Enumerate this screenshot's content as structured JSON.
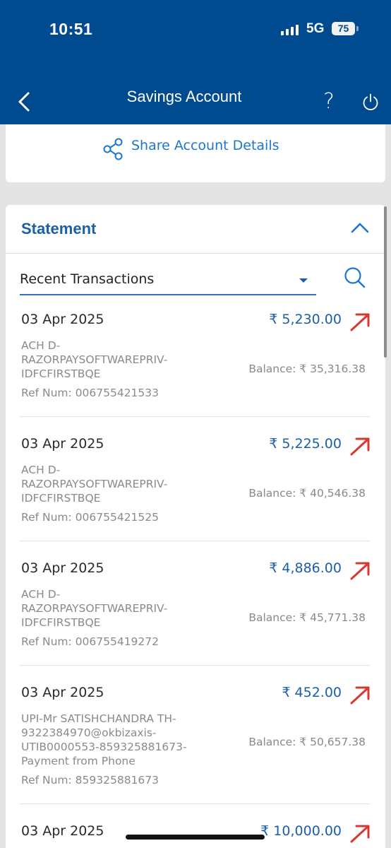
{
  "status_bar": {
    "time": "10:51",
    "network": "5G",
    "battery": "75"
  },
  "header": {
    "title": "Savings Account",
    "help": "?"
  },
  "share": {
    "label": "Share Account Details"
  },
  "statement": {
    "title": "Statement",
    "filter": {
      "selected": "Recent Transactions"
    }
  },
  "transactions": [
    {
      "date": "03 Apr 2025",
      "amount": "₹ 5,230.00",
      "desc": [
        "ACH D-",
        "RAZORPAYSOFTWAREPRIV-",
        "IDFCFIRSTBQE"
      ],
      "balance": "Balance:  ₹ 35,316.38",
      "ref": "Ref Num: 006755421533"
    },
    {
      "date": "03 Apr 2025",
      "amount": "₹ 5,225.00",
      "desc": [
        "ACH D-",
        "RAZORPAYSOFTWAREPRIV-",
        "IDFCFIRSTBQE"
      ],
      "balance": "Balance:  ₹ 40,546.38",
      "ref": "Ref Num: 006755421525"
    },
    {
      "date": "03 Apr 2025",
      "amount": "₹ 4,886.00",
      "desc": [
        "ACH D-",
        "RAZORPAYSOFTWAREPRIV-",
        "IDFCFIRSTBQE"
      ],
      "balance": "Balance:  ₹ 45,771.38",
      "ref": "Ref Num: 006755419272"
    },
    {
      "date": "03 Apr 2025",
      "amount": "₹ 452.00",
      "desc": [
        "UPI-Mr SATISHCHANDRA TH-",
        "9322384970@okbizaxis-",
        "UTIB0000553-859325881673-",
        "Payment from Phone"
      ],
      "balance": "Balance:  ₹ 50,657.38",
      "ref": "Ref Num: 859325881673"
    },
    {
      "date": "03 Apr 2025",
      "amount": "₹ 10,000.00",
      "desc": [],
      "balance": "",
      "ref": ""
    }
  ],
  "colors": {
    "header_bg": "#004a8f",
    "accent": "#1a5fa8",
    "debit_arrow": "#d63a2f"
  },
  "icons": {
    "back": "chevron-left-icon",
    "help": "question-mark-icon",
    "power": "power-icon",
    "share": "share-icon",
    "collapse": "chevron-up-icon",
    "search": "search-icon",
    "debit": "arrow-up-right-icon"
  }
}
